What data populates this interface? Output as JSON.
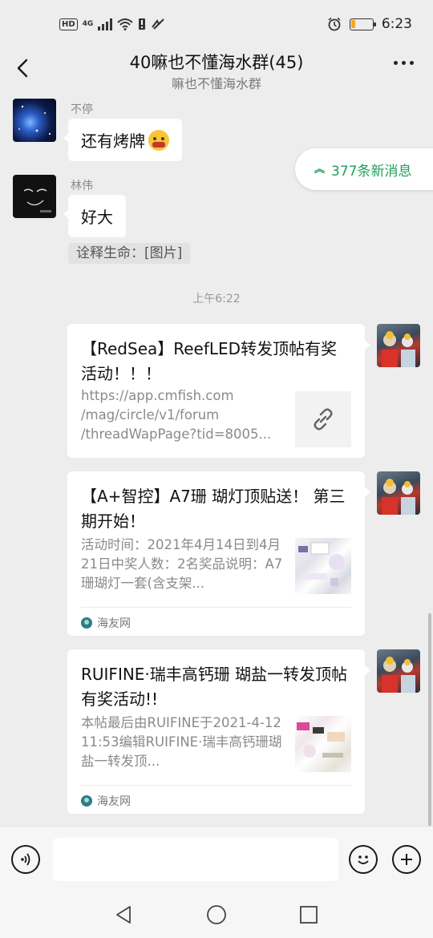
{
  "status_bar": {
    "hd": "HD",
    "network": "4G",
    "time": "6:23",
    "battery_level": 0.2
  },
  "header": {
    "title": "40嘛也不懂海水群(45)",
    "subtitle": "嘛也不懂海水群"
  },
  "new_messages": {
    "label": "377条新消息"
  },
  "messages": [
    {
      "sender": "不停",
      "text": "还有烤牌",
      "emoji": "emoji-face"
    },
    {
      "sender": "林伟",
      "text": "好大",
      "quote": "诠释生命：[图片]"
    }
  ],
  "timestamp": "上午6:22",
  "cards": [
    {
      "title": "【RedSea】ReefLED转发顶帖有奖活动！！！",
      "desc": "https://app.cmfish.com\n/mag/circle/v1/forum\n/threadWapPage?tid=8005...",
      "thumb": "link-icon"
    },
    {
      "title": "【A+智控】A7珊 瑚灯顶贴送！ 第三期开始！",
      "desc": "活动时间：2021年4月14日到4月21日中奖人数：2名奖品说明：A7珊瑚灯一套(含支架...",
      "source": "海友网"
    },
    {
      "title": "RUIFINE·瑞丰高钙珊 瑚盐一转发顶帖有奖活动!!",
      "desc": "本帖最后由RUIFINE于2021-4-1211:53编辑RUIFINE·瑞丰高钙珊瑚盐一转发顶...",
      "source": "海友网"
    }
  ],
  "input": {
    "placeholder": ""
  },
  "colors": {
    "background": "#ededed",
    "accent": "#20a05a"
  }
}
